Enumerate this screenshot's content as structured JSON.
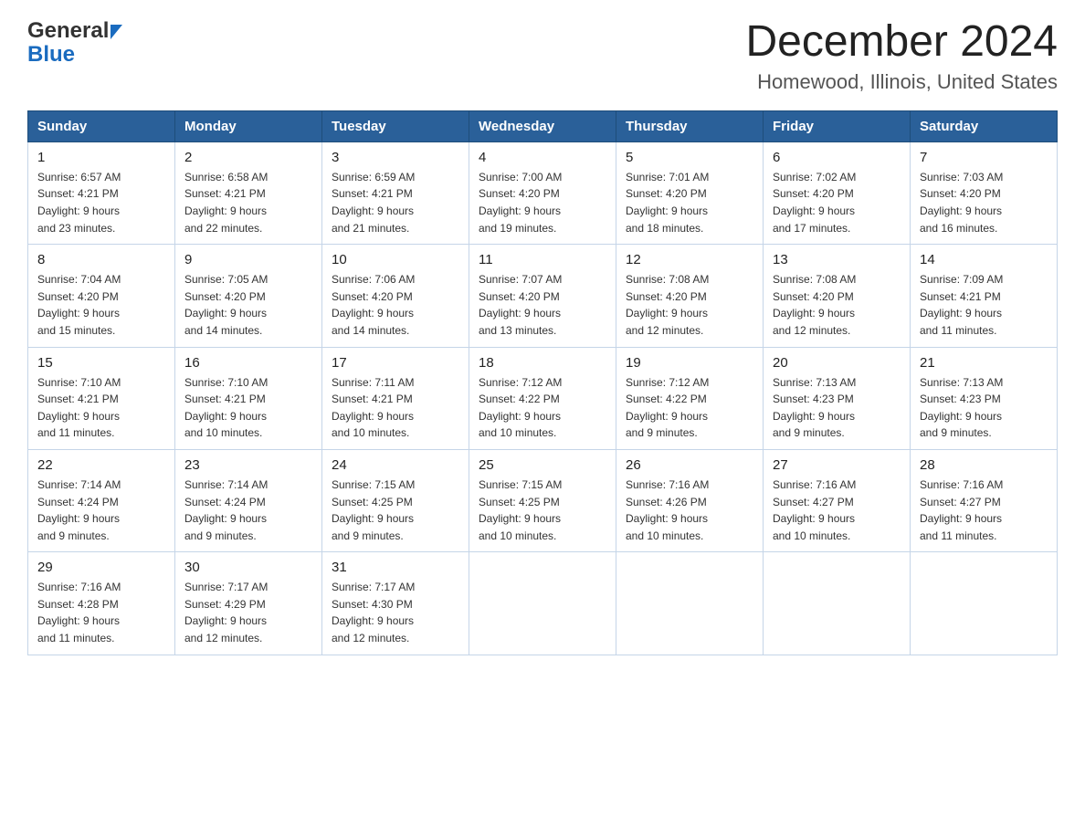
{
  "header": {
    "logo_general": "General",
    "logo_blue": "Blue",
    "month_title": "December 2024",
    "location": "Homewood, Illinois, United States"
  },
  "days_of_week": [
    "Sunday",
    "Monday",
    "Tuesday",
    "Wednesday",
    "Thursday",
    "Friday",
    "Saturday"
  ],
  "weeks": [
    [
      {
        "day": "1",
        "sunrise": "6:57 AM",
        "sunset": "4:21 PM",
        "daylight": "9 hours and 23 minutes."
      },
      {
        "day": "2",
        "sunrise": "6:58 AM",
        "sunset": "4:21 PM",
        "daylight": "9 hours and 22 minutes."
      },
      {
        "day": "3",
        "sunrise": "6:59 AM",
        "sunset": "4:21 PM",
        "daylight": "9 hours and 21 minutes."
      },
      {
        "day": "4",
        "sunrise": "7:00 AM",
        "sunset": "4:20 PM",
        "daylight": "9 hours and 19 minutes."
      },
      {
        "day": "5",
        "sunrise": "7:01 AM",
        "sunset": "4:20 PM",
        "daylight": "9 hours and 18 minutes."
      },
      {
        "day": "6",
        "sunrise": "7:02 AM",
        "sunset": "4:20 PM",
        "daylight": "9 hours and 17 minutes."
      },
      {
        "day": "7",
        "sunrise": "7:03 AM",
        "sunset": "4:20 PM",
        "daylight": "9 hours and 16 minutes."
      }
    ],
    [
      {
        "day": "8",
        "sunrise": "7:04 AM",
        "sunset": "4:20 PM",
        "daylight": "9 hours and 15 minutes."
      },
      {
        "day": "9",
        "sunrise": "7:05 AM",
        "sunset": "4:20 PM",
        "daylight": "9 hours and 14 minutes."
      },
      {
        "day": "10",
        "sunrise": "7:06 AM",
        "sunset": "4:20 PM",
        "daylight": "9 hours and 14 minutes."
      },
      {
        "day": "11",
        "sunrise": "7:07 AM",
        "sunset": "4:20 PM",
        "daylight": "9 hours and 13 minutes."
      },
      {
        "day": "12",
        "sunrise": "7:08 AM",
        "sunset": "4:20 PM",
        "daylight": "9 hours and 12 minutes."
      },
      {
        "day": "13",
        "sunrise": "7:08 AM",
        "sunset": "4:20 PM",
        "daylight": "9 hours and 12 minutes."
      },
      {
        "day": "14",
        "sunrise": "7:09 AM",
        "sunset": "4:21 PM",
        "daylight": "9 hours and 11 minutes."
      }
    ],
    [
      {
        "day": "15",
        "sunrise": "7:10 AM",
        "sunset": "4:21 PM",
        "daylight": "9 hours and 11 minutes."
      },
      {
        "day": "16",
        "sunrise": "7:10 AM",
        "sunset": "4:21 PM",
        "daylight": "9 hours and 10 minutes."
      },
      {
        "day": "17",
        "sunrise": "7:11 AM",
        "sunset": "4:21 PM",
        "daylight": "9 hours and 10 minutes."
      },
      {
        "day": "18",
        "sunrise": "7:12 AM",
        "sunset": "4:22 PM",
        "daylight": "9 hours and 10 minutes."
      },
      {
        "day": "19",
        "sunrise": "7:12 AM",
        "sunset": "4:22 PM",
        "daylight": "9 hours and 9 minutes."
      },
      {
        "day": "20",
        "sunrise": "7:13 AM",
        "sunset": "4:23 PM",
        "daylight": "9 hours and 9 minutes."
      },
      {
        "day": "21",
        "sunrise": "7:13 AM",
        "sunset": "4:23 PM",
        "daylight": "9 hours and 9 minutes."
      }
    ],
    [
      {
        "day": "22",
        "sunrise": "7:14 AM",
        "sunset": "4:24 PM",
        "daylight": "9 hours and 9 minutes."
      },
      {
        "day": "23",
        "sunrise": "7:14 AM",
        "sunset": "4:24 PM",
        "daylight": "9 hours and 9 minutes."
      },
      {
        "day": "24",
        "sunrise": "7:15 AM",
        "sunset": "4:25 PM",
        "daylight": "9 hours and 9 minutes."
      },
      {
        "day": "25",
        "sunrise": "7:15 AM",
        "sunset": "4:25 PM",
        "daylight": "9 hours and 10 minutes."
      },
      {
        "day": "26",
        "sunrise": "7:16 AM",
        "sunset": "4:26 PM",
        "daylight": "9 hours and 10 minutes."
      },
      {
        "day": "27",
        "sunrise": "7:16 AM",
        "sunset": "4:27 PM",
        "daylight": "9 hours and 10 minutes."
      },
      {
        "day": "28",
        "sunrise": "7:16 AM",
        "sunset": "4:27 PM",
        "daylight": "9 hours and 11 minutes."
      }
    ],
    [
      {
        "day": "29",
        "sunrise": "7:16 AM",
        "sunset": "4:28 PM",
        "daylight": "9 hours and 11 minutes."
      },
      {
        "day": "30",
        "sunrise": "7:17 AM",
        "sunset": "4:29 PM",
        "daylight": "9 hours and 12 minutes."
      },
      {
        "day": "31",
        "sunrise": "7:17 AM",
        "sunset": "4:30 PM",
        "daylight": "9 hours and 12 minutes."
      },
      null,
      null,
      null,
      null
    ]
  ],
  "labels": {
    "sunrise": "Sunrise:",
    "sunset": "Sunset:",
    "daylight": "Daylight:"
  }
}
